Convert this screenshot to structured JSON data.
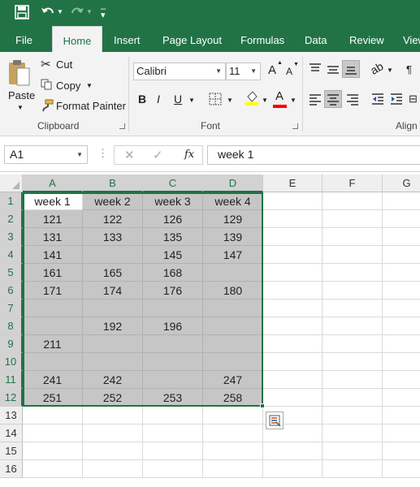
{
  "tabs": [
    "File",
    "Home",
    "Insert",
    "Page Layout",
    "Formulas",
    "Data",
    "Review",
    "View"
  ],
  "active_tab": "Home",
  "clipboard": {
    "paste": "Paste",
    "cut": "Cut",
    "copy": "Copy",
    "format_painter": "Format Painter",
    "group": "Clipboard"
  },
  "font": {
    "name": "Calibri",
    "size": "11",
    "group": "Font",
    "bold": "B",
    "italic": "I",
    "underline": "U",
    "grow": "A",
    "shrink": "A",
    "highlight_color": "#ffff00",
    "font_color": "#ff0000"
  },
  "alignment": {
    "group": "Align"
  },
  "formula_bar": {
    "name_box": "A1",
    "fx": "fx",
    "content": "week 1"
  },
  "columns": [
    "A",
    "B",
    "C",
    "D",
    "E",
    "F",
    "G"
  ],
  "rows": [
    "1",
    "2",
    "3",
    "4",
    "5",
    "6",
    "7",
    "8",
    "9",
    "10",
    "11",
    "12",
    "13",
    "14",
    "15",
    "16"
  ],
  "cells": [
    [
      "week 1",
      "week 2",
      "week 3",
      "week 4"
    ],
    [
      "121",
      "122",
      "126",
      "129"
    ],
    [
      "131",
      "133",
      "135",
      "139"
    ],
    [
      "141",
      "",
      "145",
      "147"
    ],
    [
      "161",
      "165",
      "168",
      ""
    ],
    [
      "171",
      "174",
      "176",
      "180"
    ],
    [
      "",
      "",
      "",
      ""
    ],
    [
      "",
      "192",
      "196",
      ""
    ],
    [
      "211",
      "",
      "",
      ""
    ],
    [
      "",
      "",
      "",
      ""
    ],
    [
      "241",
      "242",
      "",
      "247"
    ],
    [
      "251",
      "252",
      "253",
      "258"
    ]
  ],
  "colors": {
    "excel_green": "#217346",
    "selection_fill": "#c6c6c6"
  }
}
